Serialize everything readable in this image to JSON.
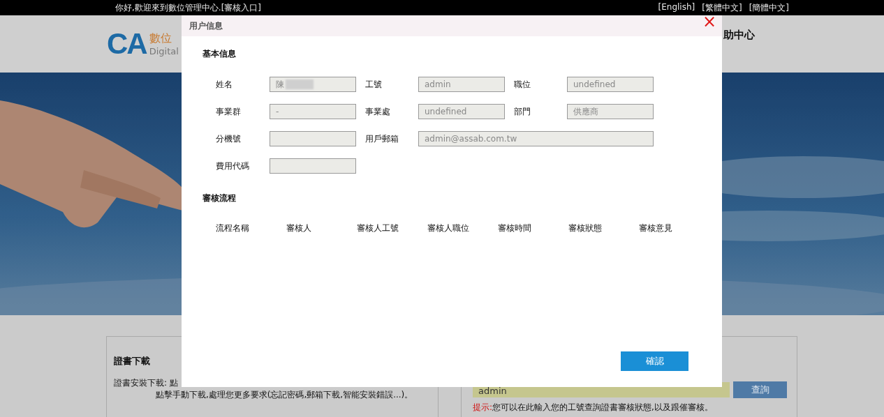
{
  "top_bar": {
    "greeting": "你好,歡迎來到數位管理中心.",
    "review_link": "[審核入口]",
    "languages": [
      "[English]",
      "[繁體中文]",
      "[簡體中文]"
    ]
  },
  "header": {
    "logo_mark": "CA",
    "logo_title": "數位",
    "logo_subtitle": "Digital",
    "nav_item": "助中心"
  },
  "download_card": {
    "title": "證書下載",
    "line_1": "證書安裝下載: 點",
    "line_2": "點擊手動下載,處理您更多要求(忘記密碼,郵箱下載,智能安裝錯誤...)。"
  },
  "query_card": {
    "field_value": "admin",
    "button": "查詢",
    "hint_label": "提示:",
    "hint_text": "您可以在此輸入您的工號查詢證書審核狀態,以及跟催審核。"
  },
  "dialog": {
    "title": "用户信息",
    "close": "×",
    "basic_section": "基本信息",
    "fields": [
      {
        "label": "姓名",
        "value": "陳",
        "redacted": true,
        "kind": "short"
      },
      {
        "label": "工號",
        "value": "admin",
        "redacted": false,
        "kind": "short"
      },
      {
        "label": "職位",
        "value": "undefined",
        "redacted": false,
        "kind": "short"
      },
      {
        "label": "事業群",
        "value": "-",
        "redacted": false,
        "kind": "short"
      },
      {
        "label": "事業處",
        "value": "undefined",
        "redacted": false,
        "kind": "short"
      },
      {
        "label": "部門",
        "value": "供應商",
        "redacted": false,
        "kind": "short"
      },
      {
        "label": "分機號",
        "redacted": false,
        "kind": "short"
      },
      {
        "label": "用戶郵箱",
        "value": "admin@assab.com.tw",
        "redacted": false,
        "kind": "wide"
      },
      {
        "label": "費用代碼",
        "redacted": false,
        "kind": "short"
      }
    ],
    "flow_section": "審核流程",
    "flow_columns": [
      "流程名稱",
      "審核人",
      "審核人工號",
      "審核人職位",
      "審核時間",
      "審核狀態",
      "審核意見"
    ],
    "confirm_button": "確認"
  }
}
